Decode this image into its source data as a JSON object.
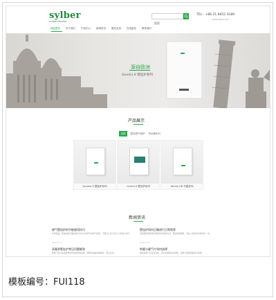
{
  "header": {
    "logo": "sylber",
    "logo_sub": "SYLBER HEATING",
    "search_placeholder": "搜索",
    "phone": "TEL：+86 21 6652 3189",
    "phone_sub": "www.sylber.com"
  },
  "nav": {
    "items": [
      "网站首页",
      "关于我们",
      "产品中心",
      "新闻资讯",
      "服务支持",
      "在线留言",
      "联系我们"
    ],
    "active_index": 0
  },
  "banner": {
    "title": "源自欧洲",
    "subtitle": "Quadra K 壁挂炉系列"
  },
  "products": {
    "title": "产品展示",
    "tabs": [
      "全部",
      "壁挂燃气锅炉",
      "热水器系列"
    ],
    "cards": [
      {
        "caption": "Quadra K 壁挂炉系列"
      },
      {
        "caption": "Centra K 壁挂炉系列"
      },
      {
        "caption": "Family HD 节能系列"
      }
    ]
  },
  "news": {
    "title": "新闻资讯",
    "items": [
      {
        "title": "燃气壁挂炉的节能使用技巧",
        "text": "冬季来临，壁挂炉的正确使用方法可以有效节省燃气费用，下面为大家介绍几个实用小技巧。",
        "date": "2018-01-12"
      },
      {
        "title": "壁挂炉如何正确进行日常保养",
        "text": "定期保养能够延长壁挂炉的使用寿命，保证供暖效果，专业人员建议每年检查一次。",
        "date": "2018-01-10"
      },
      {
        "title": "采暖季壁挂炉常见问题解答",
        "text": "整理了用户在采暖季中经常遇到的问题，帮助您快速排除故障，安心过冬。",
        "date": "2018-01-08"
      },
      {
        "title": "地暖与暖气片如何选择",
        "text": "地暖和暖气片各有优势，用户可根据房屋结构、使用习惯等因素进行选择。",
        "date": "2018-01-05"
      }
    ]
  },
  "template_label": "模板编号：FUI118",
  "colors": {
    "accent": "#2aa84a"
  }
}
